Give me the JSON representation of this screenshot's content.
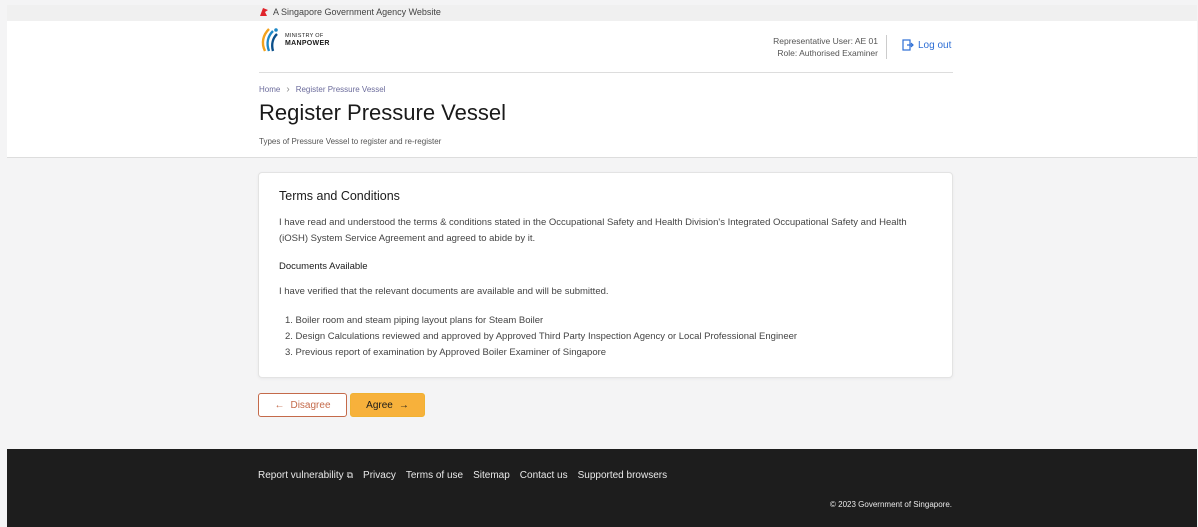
{
  "gov_bar": {
    "text": "A Singapore Government Agency Website"
  },
  "logo": {
    "line1": "MINISTRY OF",
    "line2": "MANPOWER"
  },
  "user": {
    "rep_user": "Representative User: AE 01",
    "role": "Role: Authorised Examiner",
    "logout_label": "Log out"
  },
  "breadcrumb": {
    "home": "Home",
    "current": "Register Pressure Vessel"
  },
  "page": {
    "title": "Register Pressure Vessel",
    "subtitle": "Types of Pressure Vessel to register and re-register"
  },
  "card": {
    "title": "Terms and Conditions",
    "terms_text": "I have read and understood the terms & conditions stated in the Occupational Safety and Health Division's Integrated Occupational Safety and Health (iOSH) System Service Agreement and agreed to abide by it.",
    "docs_heading": "Documents Available",
    "docs_text": "I have verified that the relevant documents are available and will be submitted.",
    "documents": [
      "1. Boiler room and steam piping layout plans for Steam Boiler",
      "2. Design Calculations reviewed and approved by Approved Third Party Inspection Agency or Local Professional Engineer",
      "3. Previous report of examination by Approved Boiler Examiner of Singapore"
    ]
  },
  "actions": {
    "disagree_label": "Disagree",
    "agree_label": "Agree"
  },
  "footer": {
    "links": [
      "Report vulnerability",
      "Privacy",
      "Terms of use",
      "Sitemap",
      "Contact us",
      "Supported browsers"
    ],
    "copyright": "© 2023 Government of Singapore."
  },
  "colors": {
    "agree": "#f7b13b",
    "disagree": "#c46a4a",
    "link": "#2d6ed5",
    "footer": "#1d1d1d"
  }
}
